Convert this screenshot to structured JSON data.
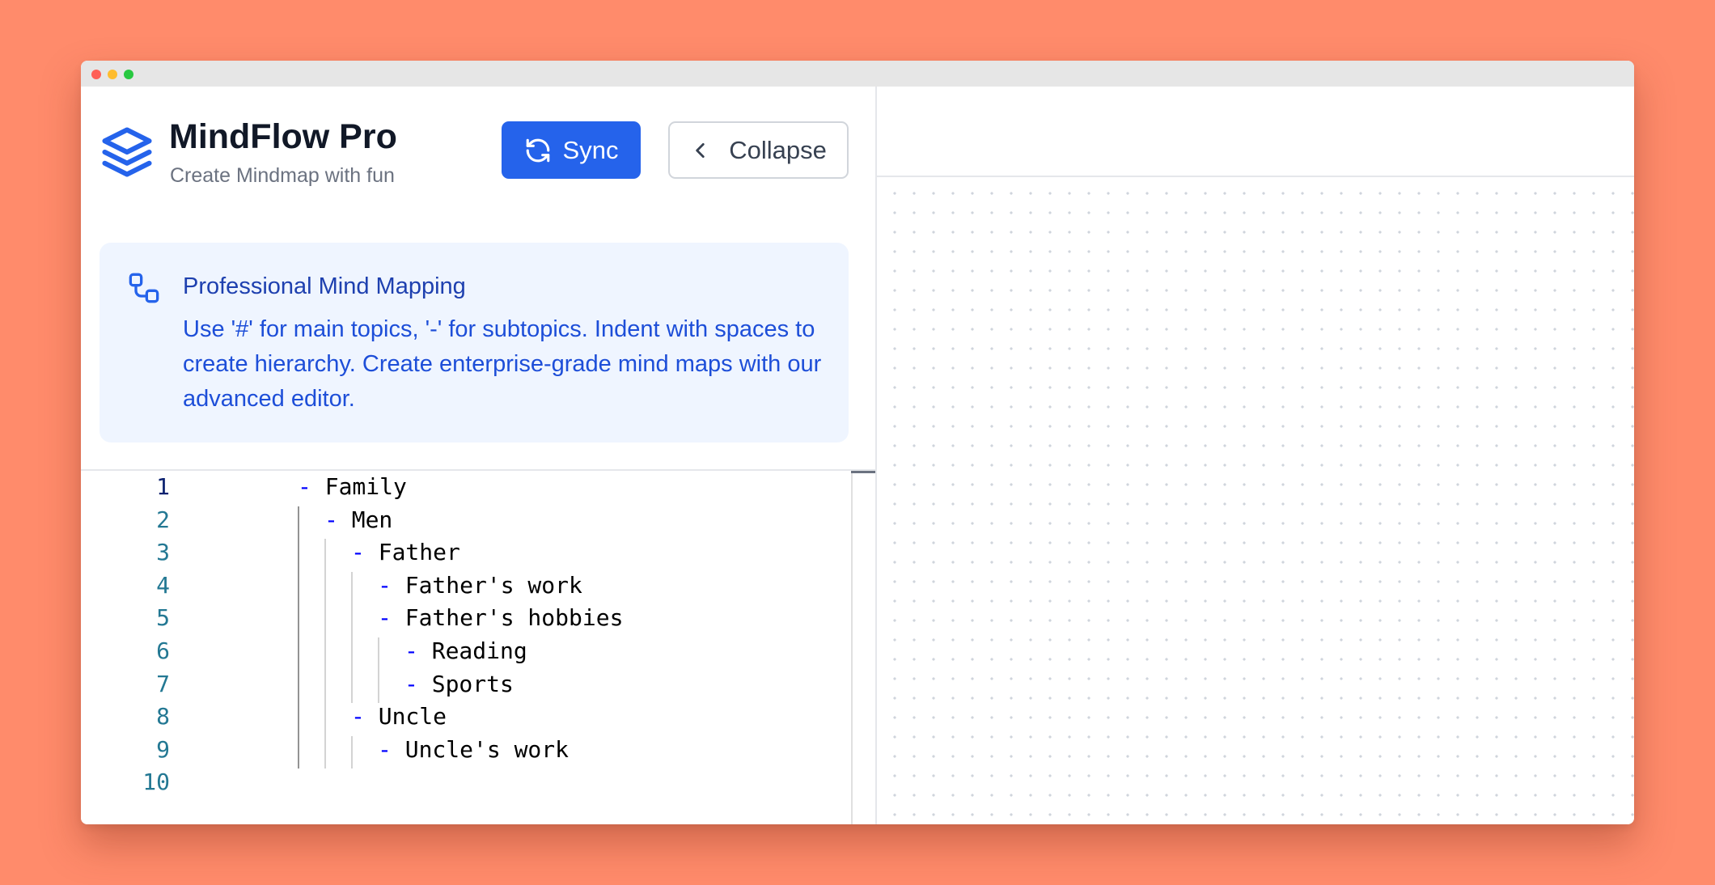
{
  "app": {
    "title": "MindFlow Pro",
    "subtitle": "Create Mindmap with fun",
    "logo_icon": "layers-icon"
  },
  "toolbar": {
    "sync_label": "Sync",
    "sync_icon": "refresh-icon",
    "collapse_label": "Collapse",
    "collapse_icon": "chevron-left-icon"
  },
  "info": {
    "icon": "diagram-nodes-icon",
    "title": "Professional Mind Mapping",
    "body": "Use '#' for main topics, '-' for subtopics. Indent with spaces to create hierarchy. Create enterprise-grade mind maps with our advanced editor."
  },
  "editor": {
    "active_line": 1,
    "lines": [
      {
        "number": "1",
        "dash": "-",
        "text": "Family",
        "indent": 0
      },
      {
        "number": "2",
        "dash": "-",
        "text": "Men",
        "indent": 1
      },
      {
        "number": "3",
        "dash": "-",
        "text": "Father",
        "indent": 2
      },
      {
        "number": "4",
        "dash": "-",
        "text": "Father's work",
        "indent": 3
      },
      {
        "number": "5",
        "dash": "-",
        "text": "Father's hobbies",
        "indent": 3
      },
      {
        "number": "6",
        "dash": "-",
        "text": "Reading",
        "indent": 4
      },
      {
        "number": "7",
        "dash": "-",
        "text": "Sports",
        "indent": 4
      },
      {
        "number": "8",
        "dash": "-",
        "text": "Uncle",
        "indent": 2
      },
      {
        "number": "9",
        "dash": "-",
        "text": "Uncle's work",
        "indent": 3
      },
      {
        "number": "10",
        "dash": "",
        "text": "",
        "indent": 0
      }
    ]
  },
  "colors": {
    "accent": "#2563eb",
    "page_background": "#ff8b6b",
    "info_background": "#eff5ff",
    "info_text": "#1d4ed8",
    "line_number": "#237893",
    "dash_token": "#0000ff"
  }
}
